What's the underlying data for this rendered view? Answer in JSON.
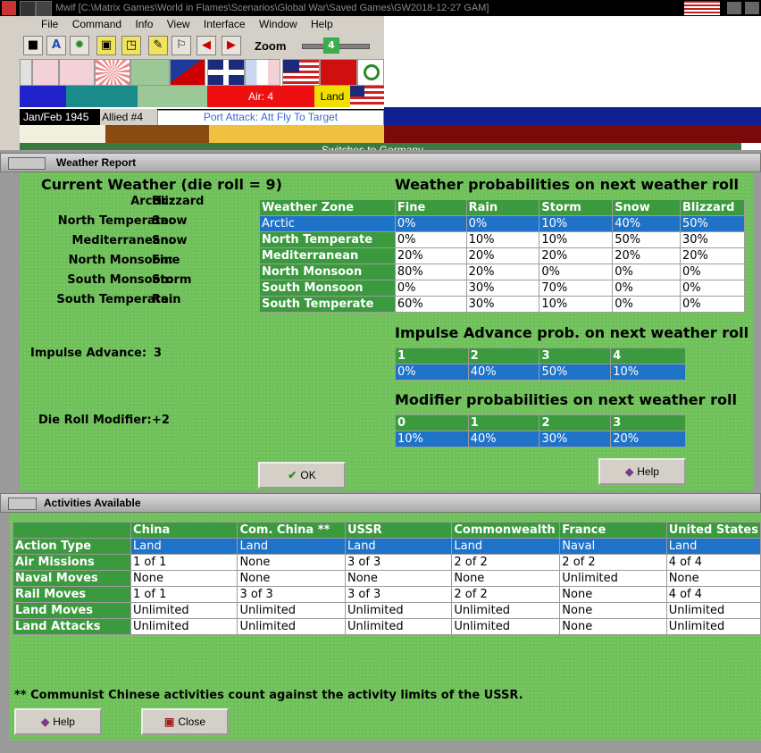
{
  "window": {
    "title": "Mwif [C:\\Matrix Games\\World in Flames\\Scenarios\\Global War\\Saved Games\\GW2018-12-27 GAM]"
  },
  "menu": [
    "File",
    "Command",
    "Info",
    "View",
    "Interface",
    "Window",
    "Help"
  ],
  "toolbar": {
    "zoom_label": "Zoom",
    "zoom_value": "4"
  },
  "status": {
    "air": "Air: 4",
    "land": "Land",
    "date": "Jan/Feb 1945",
    "side": "Allied #4",
    "action": "Port Attack: Att Fly To Target",
    "switch": "Switches to Germany"
  },
  "weather": {
    "panel_title": "Weather Report",
    "current_heading": "Current Weather (die roll = 9)",
    "zones": [
      {
        "zone": "Arctic:",
        "value": "Blizzard"
      },
      {
        "zone": "North Temperate:",
        "value": "Snow"
      },
      {
        "zone": "Mediterranean:",
        "value": "Snow"
      },
      {
        "zone": "North Monsoon:",
        "value": "Fine"
      },
      {
        "zone": "South Monsoon:",
        "value": "Storm"
      },
      {
        "zone": "South Temperate:",
        "value": "Rain"
      }
    ],
    "impulse_label": "Impulse Advance:",
    "impulse_value": "3",
    "die_mod_label": "Die Roll Modifier:",
    "die_mod_value": "+2",
    "prob_heading": "Weather probabilities on next weather roll",
    "prob_headers": [
      "Weather Zone",
      "Fine",
      "Rain",
      "Storm",
      "Snow",
      "Blizzard"
    ],
    "prob_rows": [
      [
        "Arctic",
        "0%",
        "0%",
        "10%",
        "40%",
        "50%"
      ],
      [
        "North Temperate",
        "0%",
        "10%",
        "10%",
        "50%",
        "30%"
      ],
      [
        "Mediterranean",
        "20%",
        "20%",
        "20%",
        "20%",
        "20%"
      ],
      [
        "North Monsoon",
        "80%",
        "20%",
        "0%",
        "0%",
        "0%"
      ],
      [
        "South Monsoon",
        "0%",
        "30%",
        "70%",
        "0%",
        "0%"
      ],
      [
        "South Temperate",
        "60%",
        "30%",
        "10%",
        "0%",
        "0%"
      ]
    ],
    "impulse_heading": "Impulse Advance prob. on next weather roll",
    "impulse_headers": [
      "1",
      "2",
      "3",
      "4"
    ],
    "impulse_values": [
      "0%",
      "40%",
      "50%",
      "10%"
    ],
    "modifier_heading": "Modifier probabilities on next weather roll",
    "modifier_headers": [
      "0",
      "1",
      "2",
      "3"
    ],
    "modifier_values": [
      "10%",
      "40%",
      "30%",
      "20%"
    ],
    "ok_label": "OK",
    "help_label": "Help"
  },
  "activities": {
    "panel_title": "Activities Available",
    "headers": [
      "",
      "China",
      "Com. China **",
      "USSR",
      "Commonwealth",
      "France",
      "United States"
    ],
    "rows": [
      [
        "Action Type",
        "Land",
        "Land",
        "Land",
        "Land",
        "Naval",
        "Land"
      ],
      [
        "Air Missions",
        "1 of 1",
        "None",
        "3 of 3",
        "2 of 2",
        "2 of 2",
        "4 of 4"
      ],
      [
        "Naval Moves",
        "None",
        "None",
        "None",
        "None",
        "Unlimited",
        "None"
      ],
      [
        "Rail Moves",
        "1 of 1",
        "3 of 3",
        "3 of 3",
        "2 of 2",
        "None",
        "4 of 4"
      ],
      [
        "Land Moves",
        "Unlimited",
        "Unlimited",
        "Unlimited",
        "Unlimited",
        "None",
        "Unlimited"
      ],
      [
        "Land Attacks",
        "Unlimited",
        "Unlimited",
        "Unlimited",
        "Unlimited",
        "None",
        "Unlimited"
      ]
    ],
    "footnote": "** Communist Chinese activities count against the activity limits of the USSR.",
    "help_label": "Help",
    "close_label": "Close"
  },
  "colors": {
    "panel_green": "#6fbf5b",
    "header_green": "#3a9a3d",
    "selection_blue": "#1e73c9"
  }
}
